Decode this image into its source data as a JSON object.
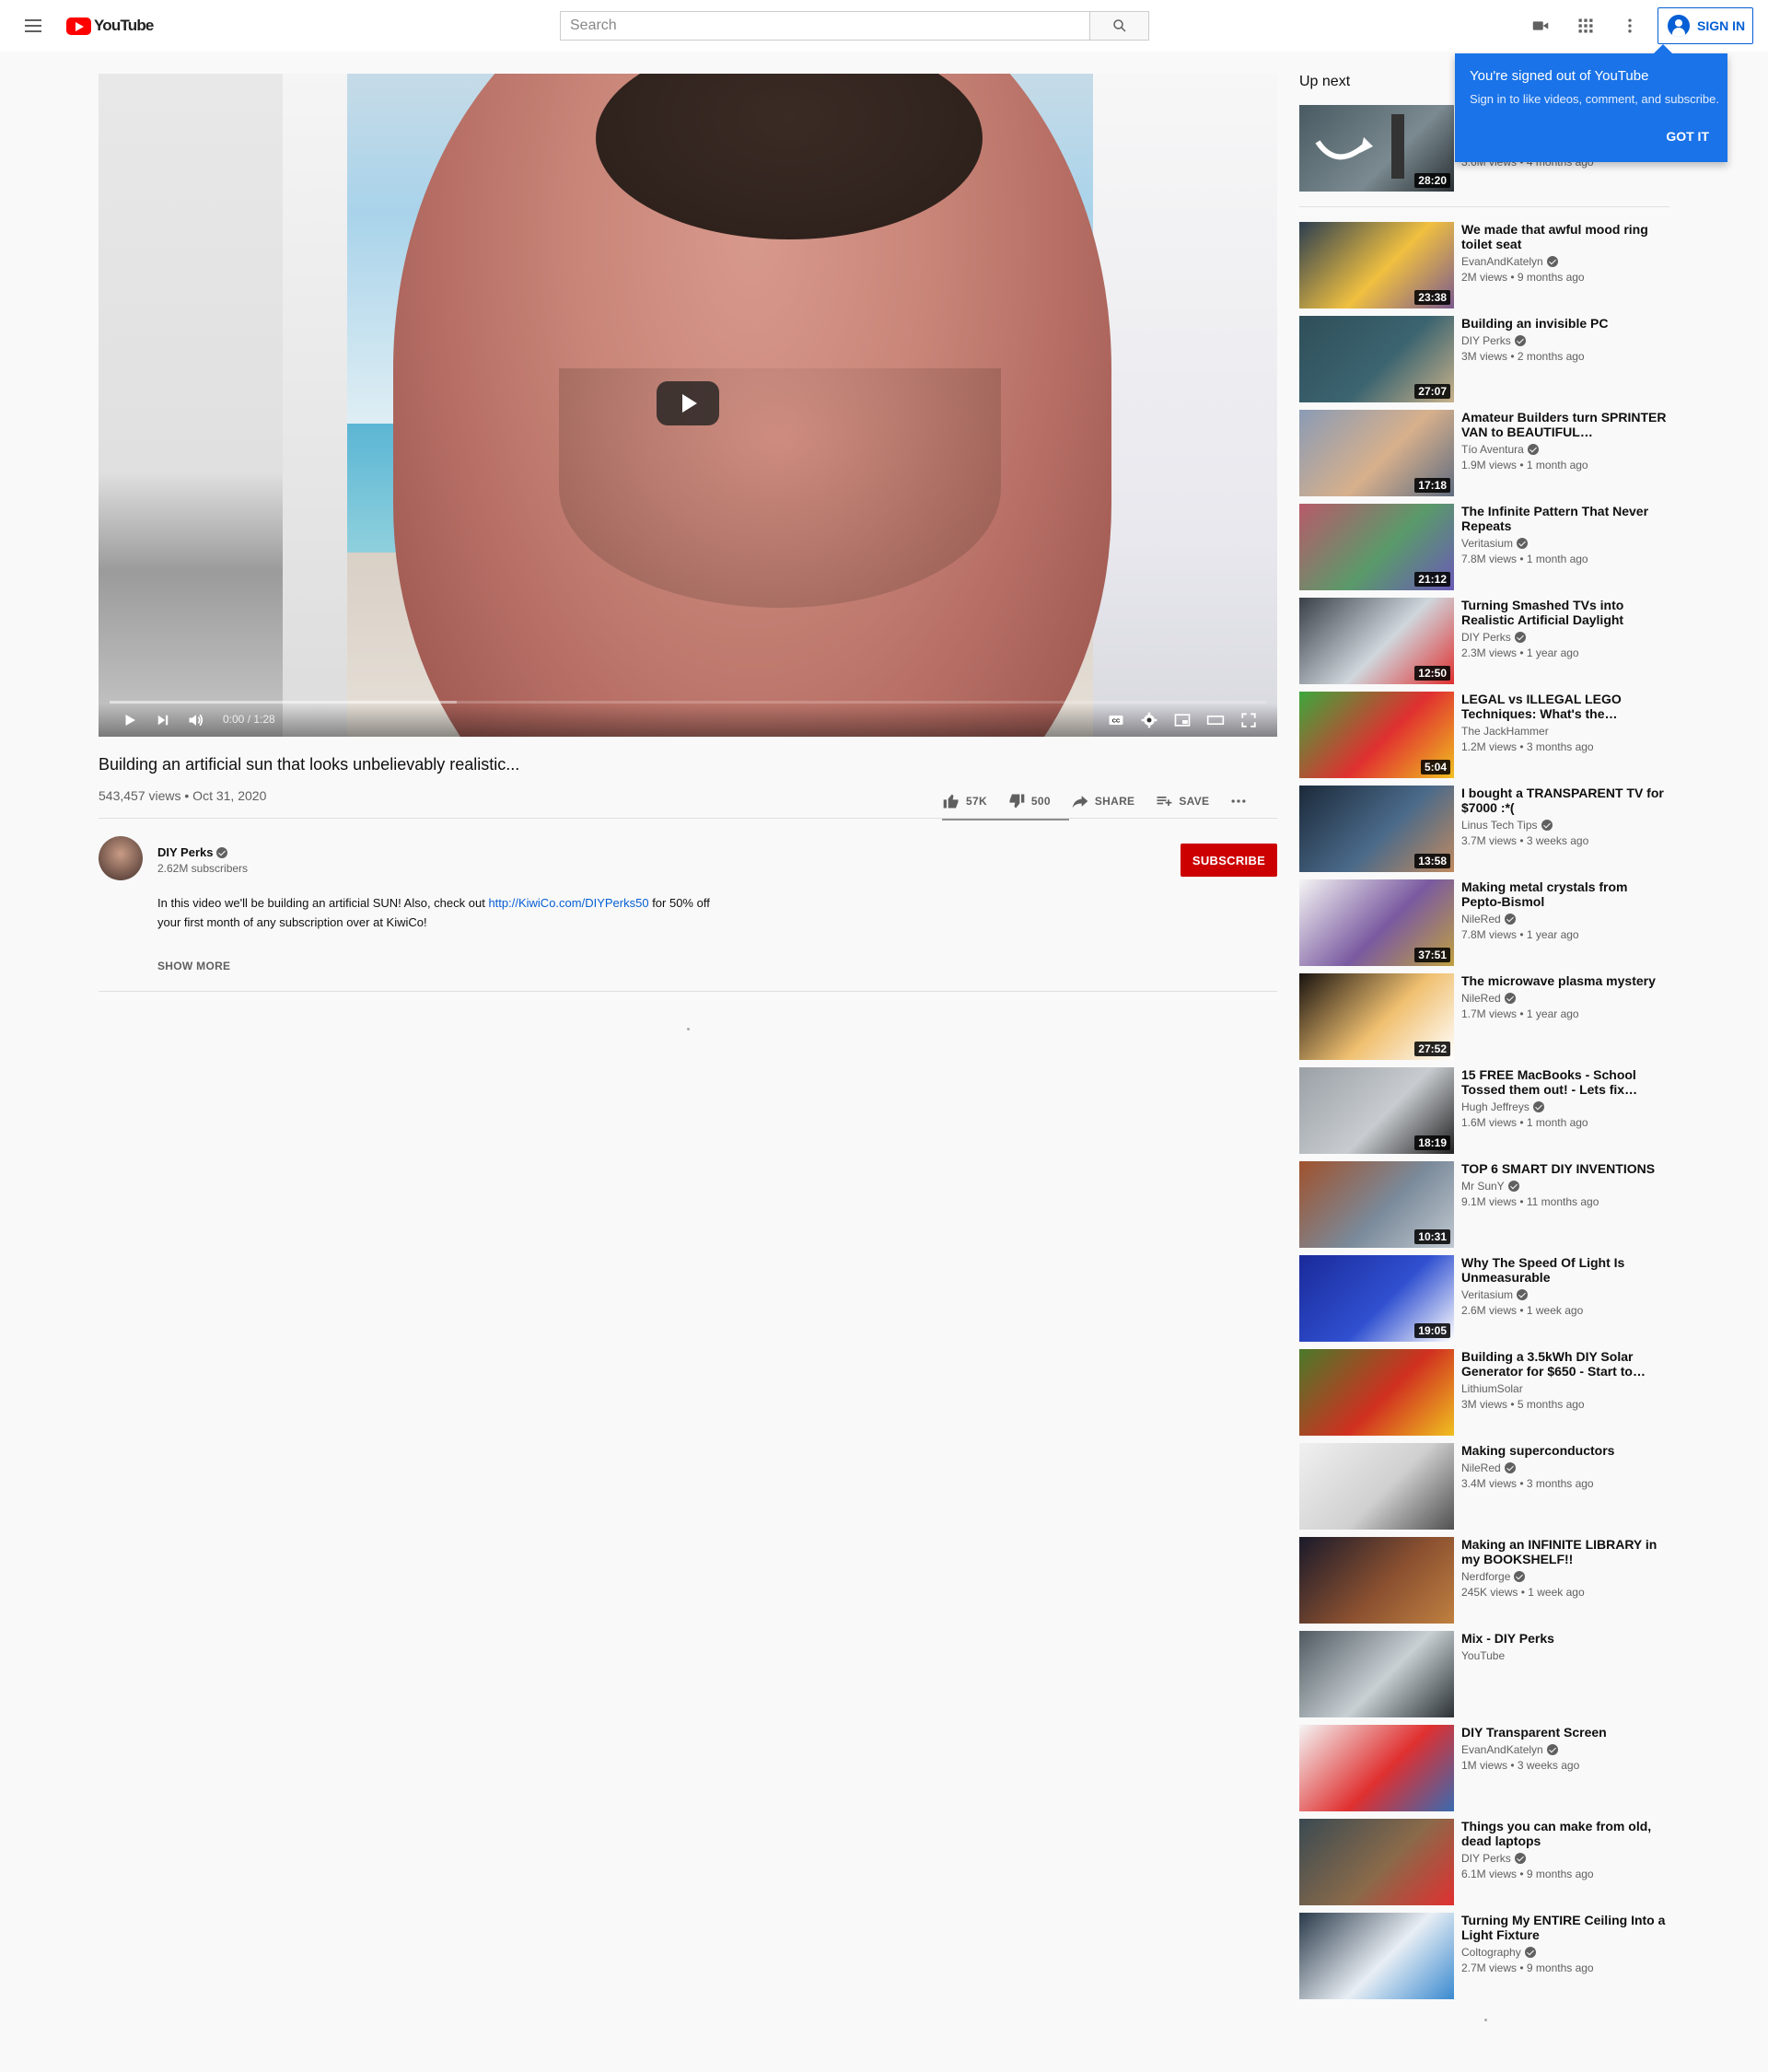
{
  "header": {
    "logo_text": "YouTube",
    "search_placeholder": "Search",
    "sign_in_label": "SIGN IN"
  },
  "tooltip": {
    "title": "You're signed out of YouTube",
    "body": "Sign in to like videos, comment, and subscribe.",
    "button": "GOT IT"
  },
  "player": {
    "time": "0:00 / 1:28"
  },
  "video": {
    "title": "Building an artificial sun that looks unbelievably realistic...",
    "meta": "543,457 views • Oct 31, 2020",
    "likes": "57K",
    "dislikes": "500",
    "share_label": "SHARE",
    "save_label": "SAVE"
  },
  "channel": {
    "name": "DIY Perks",
    "subscribers": "2.62M subscribers",
    "subscribe_label": "SUBSCRIBE"
  },
  "description": {
    "text_before": "In this video we'll be building an artificial SUN! Also, check out ",
    "link": "http://KiwiCo.com/DIYPerks50",
    "text_after": " for 50% off your first month of any subscription over at KiwiCo!",
    "show_more": "SHOW MORE"
  },
  "sidebar": {
    "up_next_label": "Up next",
    "first": {
      "duration": "28:20",
      "stats": "3.6M views • 4 months ago"
    },
    "items": [
      {
        "title": "We made that awful mood ring toilet seat",
        "channel": "EvanAndKatelyn",
        "stats": "2M views • 9 months ago",
        "duration": "23:38",
        "colors": [
          "#2c3e50",
          "#f0c040",
          "#7b5a8f"
        ]
      },
      {
        "title": "Building an invisible PC",
        "channel": "DIY Perks",
        "stats": "3M views • 2 months ago",
        "duration": "27:07",
        "colors": [
          "#2f4f5a",
          "#3b6470",
          "#c9b28a"
        ]
      },
      {
        "title": "Amateur Builders turn SPRINTER VAN to BEAUTIFUL…",
        "channel": "Tío Aventura",
        "stats": "1.9M views • 1 month ago",
        "duration": "17:18",
        "colors": [
          "#8a9bb5",
          "#d7b08c",
          "#5f6c80"
        ]
      },
      {
        "title": "The Infinite Pattern That Never Repeats",
        "channel": "Veritasium",
        "stats": "7.8M views • 1 month ago",
        "duration": "21:12",
        "colors": [
          "#b85a6a",
          "#5a9a6a",
          "#6a5ab8"
        ]
      },
      {
        "title": "Turning Smashed TVs into Realistic Artificial Daylight",
        "channel": "DIY Perks",
        "stats": "2.3M views • 1 year ago",
        "duration": "12:50",
        "colors": [
          "#3a4048",
          "#cfd6dc",
          "#e03030"
        ]
      },
      {
        "title": "LEGAL vs ILLEGAL LEGO Techniques: What's the…",
        "channel": "The JackHammer",
        "stats": "1.2M views • 3 months ago",
        "duration": "5:04",
        "colors": [
          "#3ca83c",
          "#e03030",
          "#f0c020"
        ]
      },
      {
        "title": "I bought a TRANSPARENT TV for $7000 :*(",
        "channel": "Linus Tech Tips",
        "stats": "3.7M views • 3 weeks ago",
        "duration": "13:58",
        "colors": [
          "#1c2a3a",
          "#4a6a8a",
          "#c08a60"
        ]
      },
      {
        "title": "Making metal crystals from Pepto-Bismol",
        "channel": "NileRed",
        "stats": "7.8M views • 1 year ago",
        "duration": "37:51",
        "colors": [
          "#f4f4f4",
          "#7a5aa0",
          "#c0a040"
        ]
      },
      {
        "title": "The microwave plasma mystery",
        "channel": "NileRed",
        "stats": "1.7M views • 1 year ago",
        "duration": "27:52",
        "colors": [
          "#1a1410",
          "#f0c070",
          "#ffffff"
        ]
      },
      {
        "title": "15 FREE MacBooks - School Tossed them out! - Lets fix…",
        "channel": "Hugh Jeffreys",
        "stats": "1.6M views • 1 month ago",
        "duration": "18:19",
        "colors": [
          "#9aa0a6",
          "#c8ccd0",
          "#202020"
        ]
      },
      {
        "title": "TOP 6 SMART DIY INVENTIONS",
        "channel": "Mr SunY",
        "stats": "9.1M views • 11 months ago",
        "duration": "10:31",
        "colors": [
          "#a0522d",
          "#7a8a9a",
          "#c0c8d0"
        ]
      },
      {
        "title": "Why The Speed Of Light Is Unmeasurable",
        "channel": "Veritasium",
        "stats": "2.6M views • 1 week ago",
        "duration": "19:05",
        "colors": [
          "#1a2a9a",
          "#3050d0",
          "#ffffff"
        ]
      },
      {
        "title": "Building a 3.5kWh DIY Solar Generator for $650 - Start to…",
        "channel": "LithiumSolar",
        "stats": "3M views • 5 months ago",
        "duration": "",
        "colors": [
          "#4a7a2a",
          "#d03020",
          "#f0c020"
        ]
      },
      {
        "title": "Making superconductors",
        "channel": "NileRed",
        "stats": "3.4M views • 3 months ago",
        "duration": "",
        "colors": [
          "#f0f0f0",
          "#d0d0d0",
          "#505050"
        ]
      },
      {
        "title": "Making an INFINITE LIBRARY in my BOOKSHELF!!",
        "channel": "Nerdforge",
        "stats": "245K views • 1 week ago",
        "duration": "",
        "colors": [
          "#1a1a2a",
          "#8a5030",
          "#c08040"
        ]
      },
      {
        "title": "Mix - DIY Perks",
        "channel": "YouTube",
        "stats": "",
        "duration": "",
        "colors": [
          "#505a60",
          "#c8d0d4",
          "#2a3034"
        ]
      },
      {
        "title": "DIY Transparent Screen",
        "channel": "EvanAndKatelyn",
        "stats": "1M views • 3 weeks ago",
        "duration": "",
        "colors": [
          "#f4f4f4",
          "#e03030",
          "#3a6ab0"
        ]
      },
      {
        "title": "Things you can make from old, dead laptops",
        "channel": "DIY Perks",
        "stats": "6.1M views • 9 months ago",
        "duration": "",
        "colors": [
          "#3a4a52",
          "#8a6a4a",
          "#e03030"
        ]
      },
      {
        "title": "Turning My ENTIRE Ceiling Into a Light Fixture",
        "channel": "Coltography",
        "stats": "2.7M views • 9 months ago",
        "duration": "",
        "colors": [
          "#2a3a4a",
          "#e8eef4",
          "#3a8ad0"
        ]
      }
    ]
  }
}
